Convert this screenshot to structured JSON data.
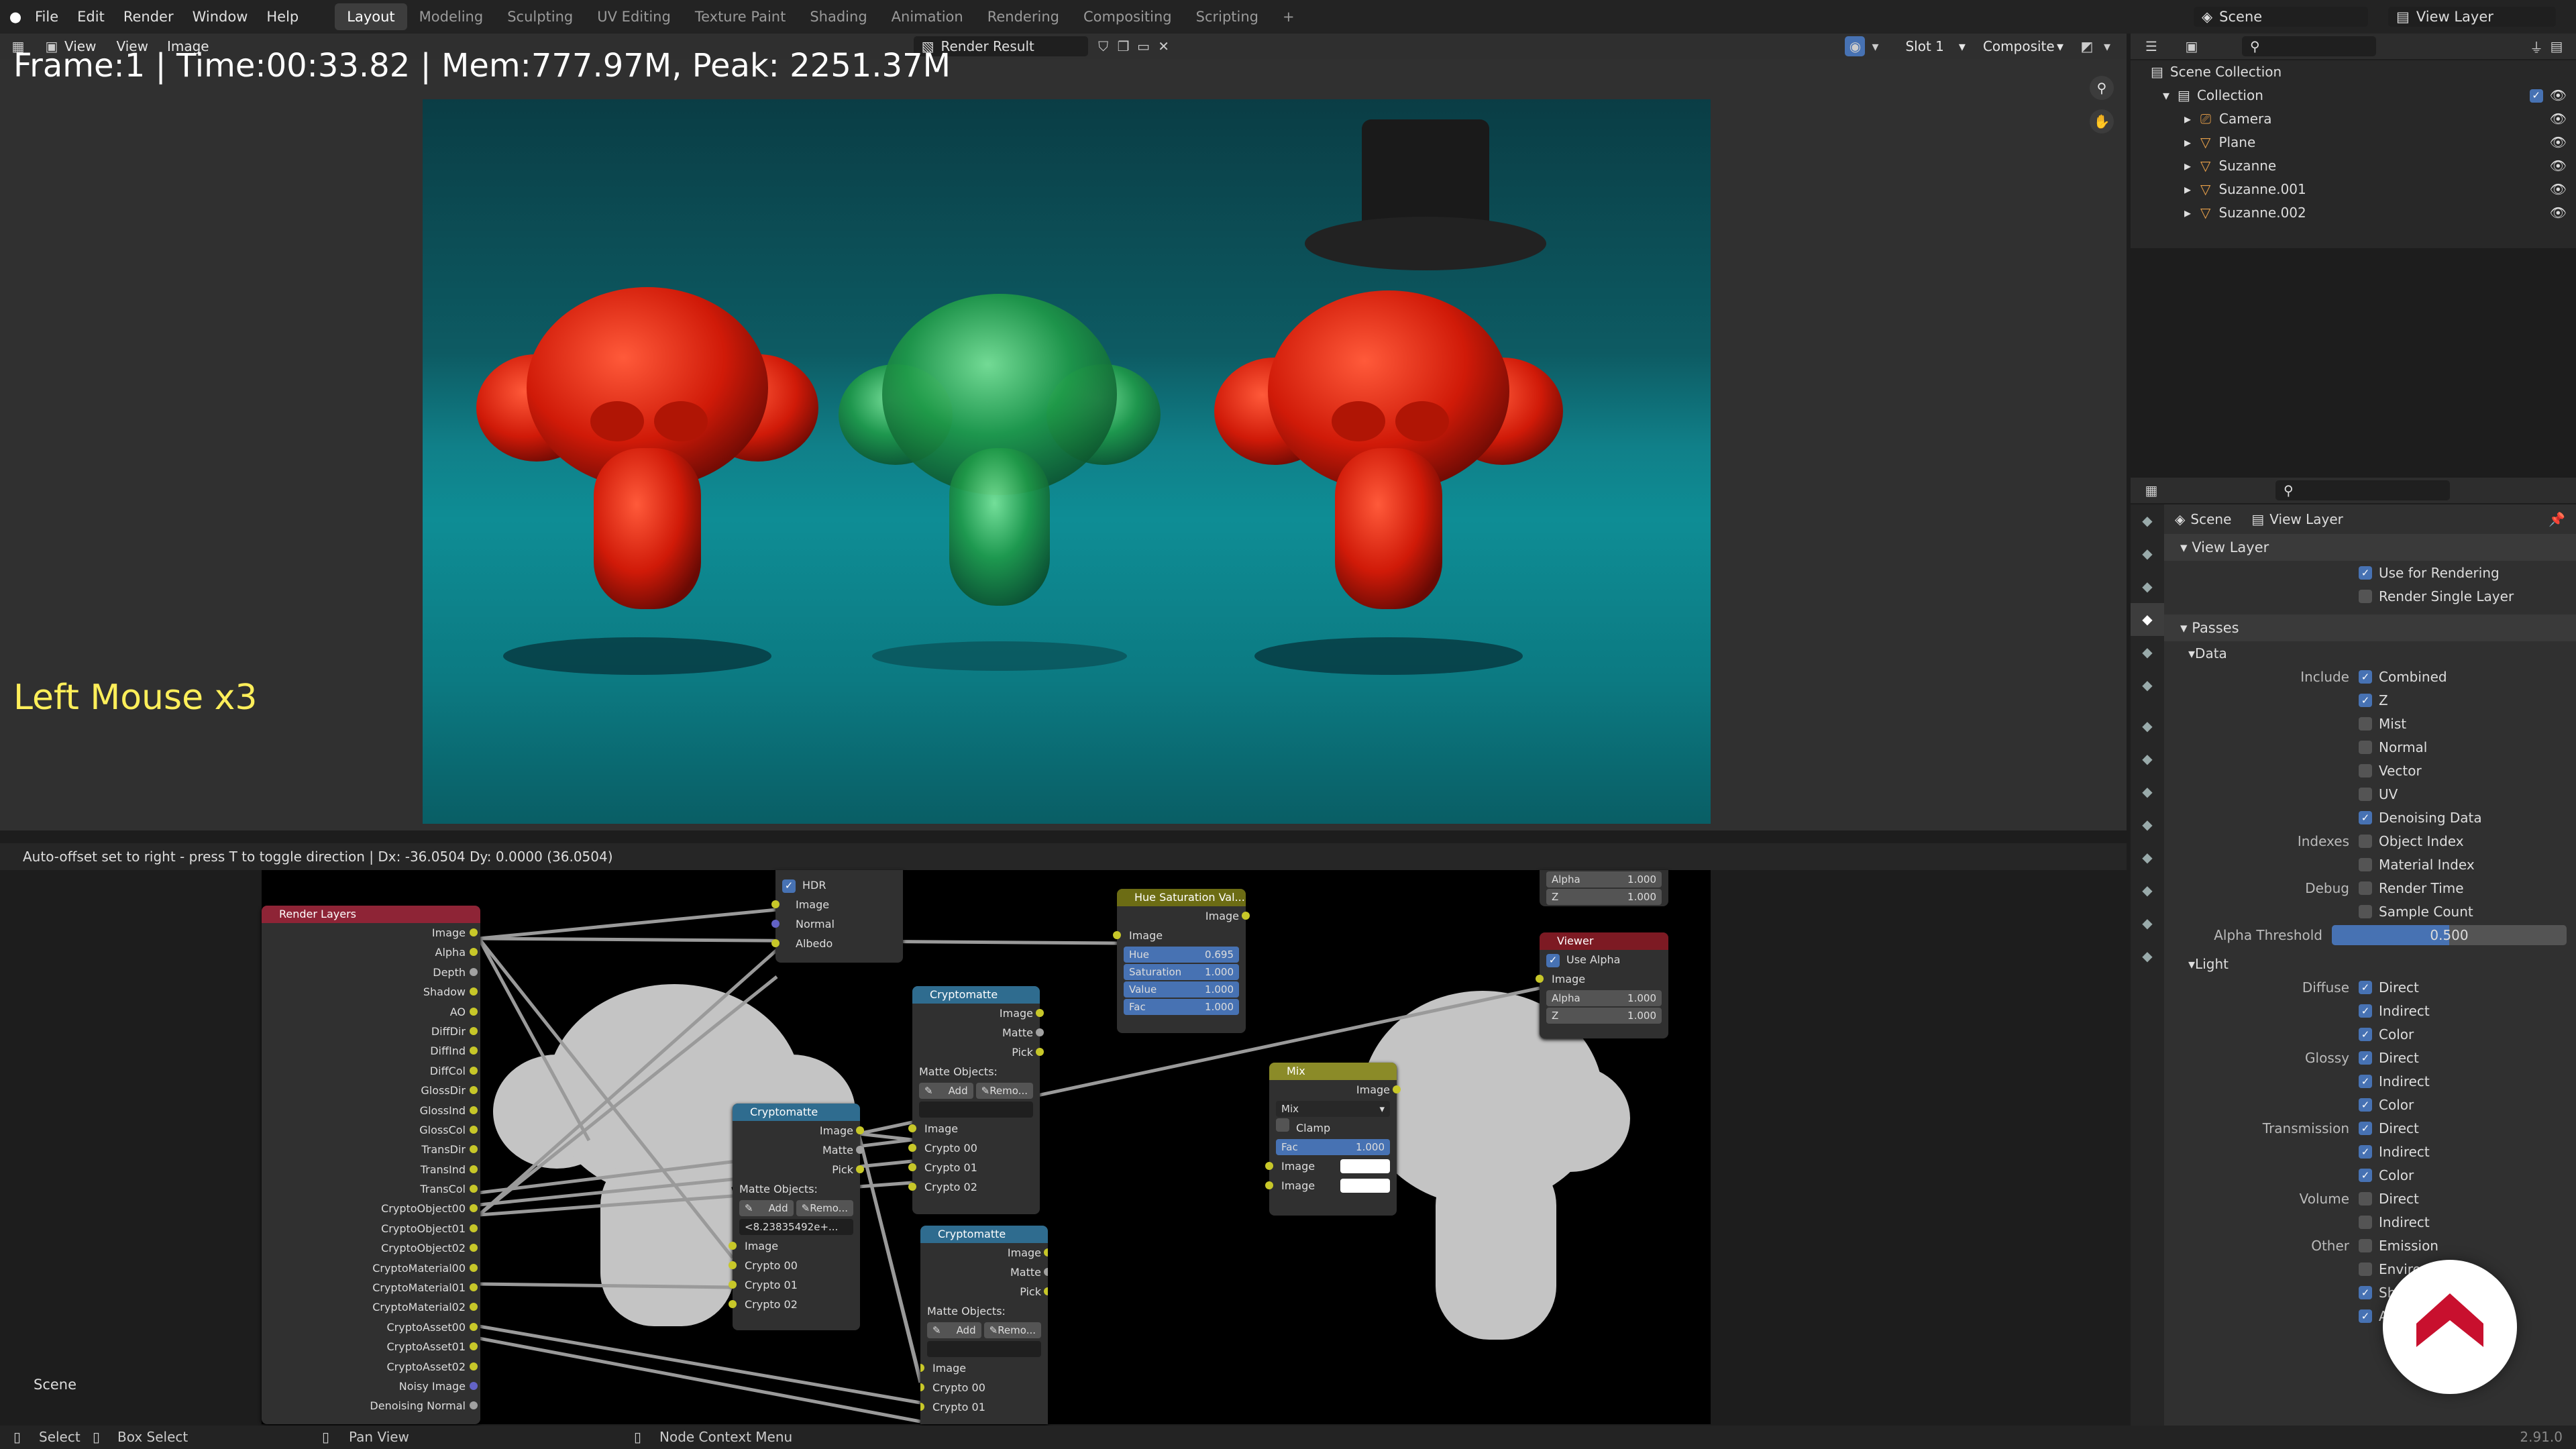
{
  "topbar": {
    "menus": [
      "File",
      "Edit",
      "Render",
      "Window",
      "Help"
    ],
    "workspaces": [
      "Layout",
      "Modeling",
      "Sculpting",
      "UV Editing",
      "Texture Paint",
      "Shading",
      "Animation",
      "Rendering",
      "Compositing",
      "Scripting"
    ],
    "add": "+",
    "scene": "Scene",
    "view_layer": "View Layer"
  },
  "image_editor": {
    "view": "View",
    "view2": "View",
    "image": "Image",
    "image_name": "Render Result",
    "slot": "Slot 1",
    "pass": "Composite",
    "stamp": "Frame:1 | Time:00:33.82 | Mem:777.97M, Peak: 2251.37M",
    "key_overlay": "Left Mouse x3",
    "status": "Auto-offset set to right - press T to toggle direction  |  Dx: -36.0504   Dy: 0.0000 (36.0504)"
  },
  "nodes": {
    "render_layers": {
      "title": "Render Layers",
      "outputs": [
        "Image",
        "Alpha",
        "Depth",
        "Shadow",
        "AO",
        "DiffDir",
        "DiffInd",
        "DiffCol",
        "GlossDir",
        "GlossInd",
        "GlossCol",
        "TransDir",
        "TransInd",
        "TransCol",
        "CryptoObject00",
        "CryptoObject01",
        "CryptoObject02",
        "CryptoMaterial00",
        "CryptoMaterial01",
        "CryptoMaterial02",
        "CryptoAsset00",
        "CryptoAsset01",
        "CryptoAsset02",
        "Noisy Image",
        "Denoising Normal"
      ]
    },
    "denoise": {
      "hdr": "HDR",
      "inputs": [
        "Image",
        "Normal",
        "Albedo"
      ]
    },
    "crypto1": {
      "title": "Cryptomatte",
      "outputs": [
        "Image",
        "Matte",
        "Pick"
      ],
      "matte_label": "Matte Objects:",
      "add": "Add",
      "remove": "Remo...",
      "value": "<8.23835492e+...",
      "inputs": [
        "Image",
        "Crypto 00",
        "Crypto 01",
        "Crypto 02"
      ]
    },
    "crypto2": {
      "title": "Cryptomatte",
      "outputs": [
        "Image",
        "Matte",
        "Pick"
      ],
      "matte_label": "Matte Objects:",
      "add": "Add",
      "remove": "Remo...",
      "inputs": [
        "Image",
        "Crypto 00",
        "Crypto 01",
        "Crypto 02"
      ]
    },
    "crypto3": {
      "title": "Cryptomatte",
      "outputs": [
        "Image",
        "Matte",
        "Pick"
      ],
      "matte_label": "Matte Objects:",
      "add": "Add",
      "remove": "Remo...",
      "inputs": [
        "Image",
        "Crypto 00",
        "Crypto 01"
      ]
    },
    "hsv": {
      "title": "Hue Saturation Val...",
      "output": "Image",
      "input": "Image",
      "fields": [
        {
          "k": "Hue",
          "v": "0.695"
        },
        {
          "k": "Saturation",
          "v": "1.000"
        },
        {
          "k": "Value",
          "v": "1.000"
        },
        {
          "k": "Fac",
          "v": "1.000"
        }
      ]
    },
    "viewer": {
      "title": "Viewer",
      "use_alpha": "Use Alpha",
      "inputs": [
        "Image"
      ],
      "fields": [
        {
          "k": "Alpha",
          "v": "1.000"
        },
        {
          "k": "Z",
          "v": "1.000"
        }
      ]
    },
    "composite_partial": {
      "fields": [
        {
          "k": "Alpha",
          "v": "1.000"
        },
        {
          "k": "Z",
          "v": "1.000"
        }
      ]
    },
    "mix": {
      "title": "Mix",
      "output": "Image",
      "blend": "Mix",
      "clamp": "Clamp",
      "fac_k": "Fac",
      "fac_v": "1.000",
      "inputs": [
        "Image",
        "Image"
      ]
    }
  },
  "node_scene_label": "Scene",
  "outliner": {
    "root": "Scene Collection",
    "collection": "Collection",
    "items": [
      "Camera",
      "Plane",
      "Suzanne",
      "Suzanne.001",
      "Suzanne.002"
    ]
  },
  "properties": {
    "breadcrumb": [
      "Scene",
      "View Layer"
    ],
    "view_layer": {
      "title": "View Layer",
      "use_render": "Use for Rendering",
      "single": "Render Single Layer"
    },
    "passes": {
      "title": "Passes",
      "data": {
        "title": "Data",
        "include_label": "Include",
        "include": [
          {
            "l": "Combined",
            "on": true
          },
          {
            "l": "Z",
            "on": true
          },
          {
            "l": "Mist",
            "on": false
          },
          {
            "l": "Normal",
            "on": false
          },
          {
            "l": "Vector",
            "on": false
          },
          {
            "l": "UV",
            "on": false
          },
          {
            "l": "Denoising Data",
            "on": true
          }
        ],
        "indexes_label": "Indexes",
        "indexes": [
          {
            "l": "Object Index",
            "on": false
          },
          {
            "l": "Material Index",
            "on": false
          }
        ],
        "debug_label": "Debug",
        "debug": [
          {
            "l": "Render Time",
            "on": false
          },
          {
            "l": "Sample Count",
            "on": false
          }
        ],
        "alpha_label": "Alpha Threshold",
        "alpha_value": "0.500",
        "alpha_fill": 0.5
      },
      "light": {
        "title": "Light",
        "groups": [
          {
            "label": "Diffuse",
            "items": [
              {
                "l": "Direct",
                "on": true
              },
              {
                "l": "Indirect",
                "on": true
              },
              {
                "l": "Color",
                "on": true
              }
            ]
          },
          {
            "label": "Glossy",
            "items": [
              {
                "l": "Direct",
                "on": true
              },
              {
                "l": "Indirect",
                "on": true
              },
              {
                "l": "Color",
                "on": true
              }
            ]
          },
          {
            "label": "Transmission",
            "items": [
              {
                "l": "Direct",
                "on": true
              },
              {
                "l": "Indirect",
                "on": true
              },
              {
                "l": "Color",
                "on": true
              }
            ]
          },
          {
            "label": "Volume",
            "items": [
              {
                "l": "Direct",
                "on": false
              },
              {
                "l": "Indirect",
                "on": false
              }
            ]
          },
          {
            "label": "Other",
            "items": [
              {
                "l": "Emission",
                "on": false
              },
              {
                "l": "Environment",
                "on": false
              },
              {
                "l": "Shadow",
                "on": true
              },
              {
                "l": "Ambient Occlusion",
                "on": true
              }
            ]
          }
        ]
      }
    }
  },
  "statusbar": {
    "select": "Select",
    "box_select": "Box Select",
    "pan": "Pan View",
    "context": "Node Context Menu",
    "version": "2.91.0"
  },
  "colors": {
    "render_layers_header": "#8e2436",
    "crypto_header": "#2f6c8f",
    "hsv_header": "#6c6c14",
    "mix_header": "#8b8b28",
    "viewer_header": "#7d1a23",
    "accent": "#4772b3"
  }
}
